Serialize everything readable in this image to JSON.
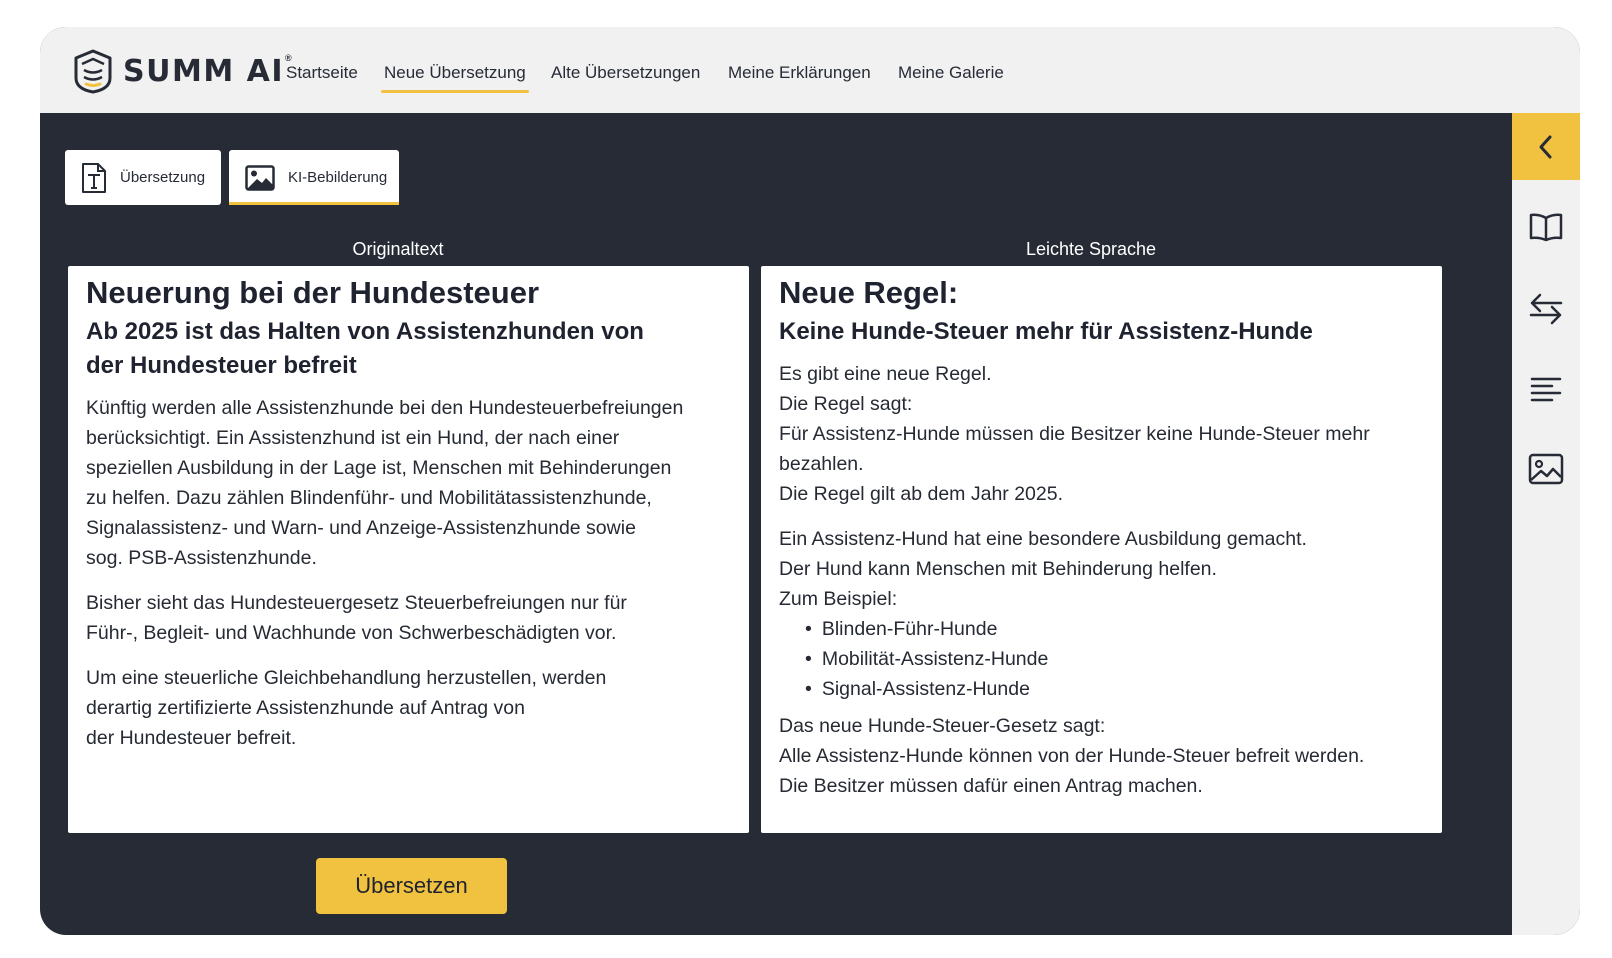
{
  "brand": {
    "name": "SUMM AI",
    "registered": "®"
  },
  "nav": {
    "items": [
      {
        "label": "Startseite"
      },
      {
        "label": "Neue Übersetzung",
        "active": true
      },
      {
        "label": "Alte Übersetzungen"
      },
      {
        "label": "Meine Erklärungen"
      },
      {
        "label": "Meine Galerie"
      }
    ]
  },
  "tabs": [
    {
      "label": "Übersetzung",
      "icon": "text-document-icon"
    },
    {
      "label": "KI-Bebilderung",
      "icon": "image-icon",
      "active": true
    }
  ],
  "original": {
    "label": "Originaltext",
    "title": "Neuerung bei der Hundesteuer",
    "subtitle_lines": [
      "Ab 2025 ist das Halten von Assistenzhunden von",
      "der Hundesteuer befreit"
    ],
    "paragraphs": [
      [
        "Künftig werden alle Assistenzhunde bei den Hundesteuerbefreiungen",
        "berücksichtigt. Ein Assistenzhund ist ein Hund, der nach einer",
        "speziellen Ausbildung in der Lage ist, Menschen mit Behinderungen",
        "zu helfen. Dazu zählen Blindenführ- und Mobilitätassistenzhunde,",
        "Signalassistenz- und Warn- und Anzeige-Assistenzhunde sowie",
        "sog. PSB-Assistenzhunde."
      ],
      [
        "Bisher sieht das Hundesteuergesetz Steuerbefreiungen nur für",
        "Führ-, Begleit- und Wachhunde von Schwerbeschädigten vor."
      ],
      [
        "Um eine steuerliche Gleichbehandlung herzustellen, werden",
        "derartig zertifizierte Assistenzhunde auf Antrag von",
        "der Hundesteuer befreit."
      ]
    ]
  },
  "simple": {
    "label": "Leichte Sprache",
    "title": "Neue Regel:",
    "subtitle": "Keine Hunde-Steuer mehr für Assistenz-Hunde",
    "paragraph1": [
      "Es gibt eine neue Regel.",
      "Die Regel sagt:",
      "Für Assistenz-Hunde müssen die Besitzer keine Hunde-Steuer mehr",
      "bezahlen.",
      "Die Regel gilt ab dem Jahr 2025."
    ],
    "paragraph2": [
      "Ein Assistenz-Hund hat eine besondere Ausbildung gemacht.",
      "Der Hund kann Menschen mit Behinderung helfen.",
      "Zum Beispiel:"
    ],
    "examples": [
      "Blinden-Führ-Hunde",
      "Mobilität-Assistenz-Hunde",
      "Signal-Assistenz-Hunde"
    ],
    "paragraph3": [
      "Das neue Hunde-Steuer-Gesetz sagt:",
      "Alle Assistenz-Hunde können von der Hunde-Steuer befreit werden.",
      "Die Besitzer müssen dafür einen Antrag machen."
    ]
  },
  "actions": {
    "translate_label": "Übersetzen"
  },
  "sidebar": {
    "icons": [
      "chevron-left-icon",
      "book-icon",
      "swap-arrows-icon",
      "text-lines-icon",
      "image-icon"
    ]
  },
  "colors": {
    "accent": "#f0c23f",
    "dark": "#262b36",
    "light": "#f1f1f2"
  }
}
